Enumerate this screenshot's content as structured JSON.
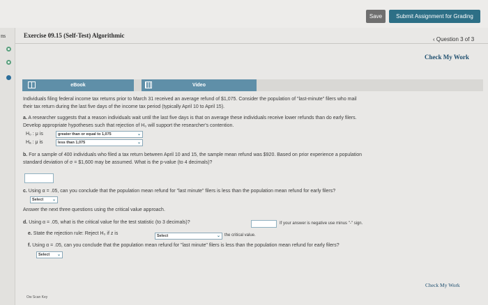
{
  "toolbar": {
    "save_label": "Save",
    "submit_label": "Submit Assignment for Grading"
  },
  "sidebar": {
    "fragment": "ns"
  },
  "header": {
    "exercise_title": "Exercise 09.15 (Self-Test) Algorithmic",
    "question_nav": "‹ Question 3 of 3",
    "check_my_work": "Check My Work"
  },
  "tabs": {
    "ebook": "eBook",
    "video": "Video"
  },
  "problem": {
    "intro_1": "Individuals filing federal income tax returns prior to March 31 received an average refund of $1,075. Consider the population of \"last-minute\" filers who mail",
    "intro_2": "their tax return during the last five days of the income tax period (typically April 10 to April 15).",
    "a_label": "a.",
    "a_1": "A researcher suggests that a reason individuals wait until the last five days is that on average these individuals receive lower refunds than do early filers.",
    "a_2": "Develop appropriate hypotheses such that rejection of H₀ will support the researcher's contention.",
    "h0_label": "H₀ : μ is",
    "h0_select": "greater than or equal to 1,075",
    "ha_label": "Hₐ : μ is",
    "ha_select": "less than 1,075",
    "b_label": "b.",
    "b_1": "For a sample of 400 individuals who filed a tax return between April 10 and 15, the sample mean refund was $920. Based on prior experience a population",
    "b_2": "standard deviation of σ = $1,600 may be assumed. What is the p-value (to 4 decimals)?",
    "c_label": "c.",
    "c_text": "Using α = .05, can you conclude that the population mean refund for \"last minute\" filers is less than the population mean refund for early filers?",
    "c_select": "Select",
    "critical_intro": "Answer the next three questions using the critical value approach.",
    "d_label": "d.",
    "d_text": "Using α = .05, what is the critical value for the test statistic (to 3 decimals)?",
    "d_note": "If your answer is negative use minus \"-\" sign.",
    "e_label": "e.",
    "e_text": "State the rejection rule: Reject H₀ if z is",
    "e_select": "Select",
    "e_after": "the critical value.",
    "f_label": "f.",
    "f_text": "Using α = .05, can you conclude that the population mean refund for \"last minute\" filers is less than the population mean refund for early filers?",
    "f_select": "Select"
  },
  "footer": {
    "check_my_work": "Check My Work",
    "note": "Ow Scan Key"
  },
  "colors": {
    "accent": "#2d6f86",
    "tab": "#5f8fa8",
    "save": "#6f6f6f"
  }
}
